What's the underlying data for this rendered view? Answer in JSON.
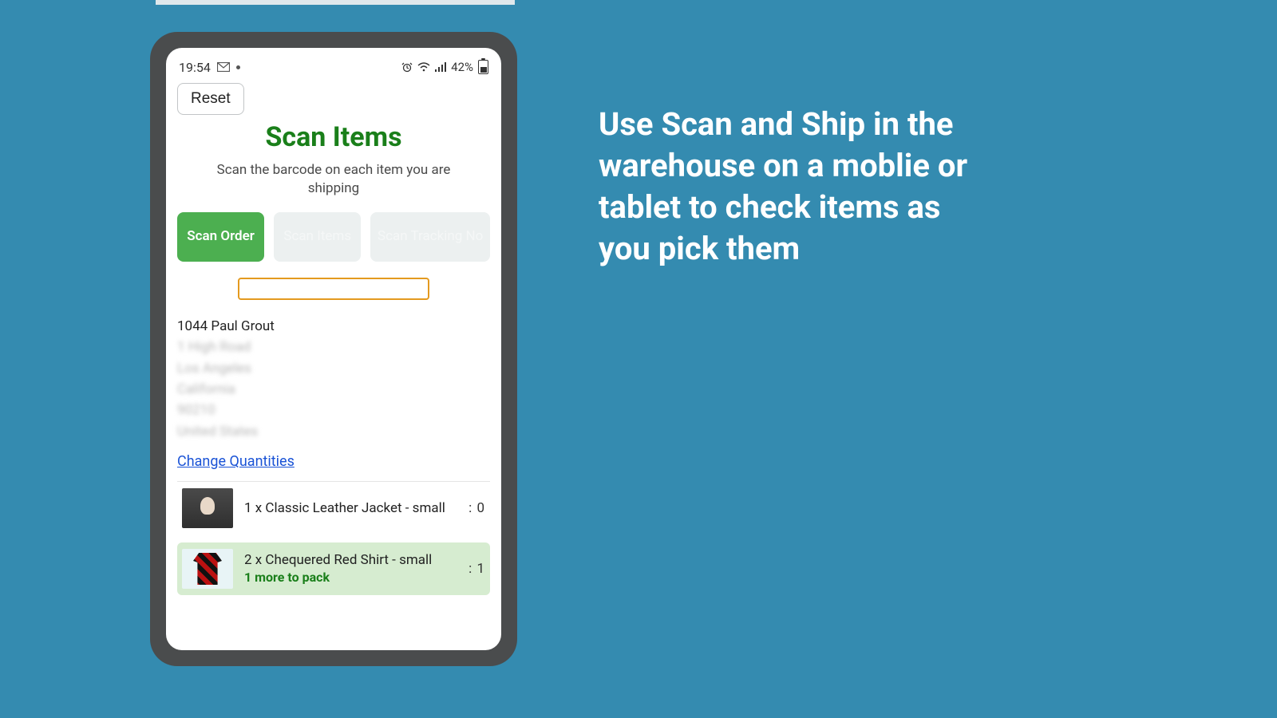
{
  "caption": "Use Scan and Ship in the warehouse on a moblie or tablet to check items as you pick them",
  "statusbar": {
    "time": "19:54",
    "battery": "42%"
  },
  "reset_label": "Reset",
  "page_title": "Scan Items",
  "subtitle": "Scan the barcode on each item you are shipping",
  "tabs": {
    "scan_order": "Scan Order",
    "scan_items": "Scan Items",
    "scan_tracking": "Scan Tracking No"
  },
  "order": {
    "name_line": "1044 Paul Grout",
    "addr1": "1 High Road",
    "city": "Los Angeles",
    "state": "California",
    "zip": "90210",
    "country": "United States"
  },
  "change_quantities": "Change Quantities",
  "items": [
    {
      "label": "1 x Classic Leather Jacket - small",
      "count": ": 0",
      "pack_more": "",
      "highlight": false,
      "thumb": "jacket"
    },
    {
      "label": "2 x Chequered Red Shirt - small",
      "count": ": 1",
      "pack_more": "1 more to pack",
      "highlight": true,
      "thumb": "shirt"
    }
  ]
}
